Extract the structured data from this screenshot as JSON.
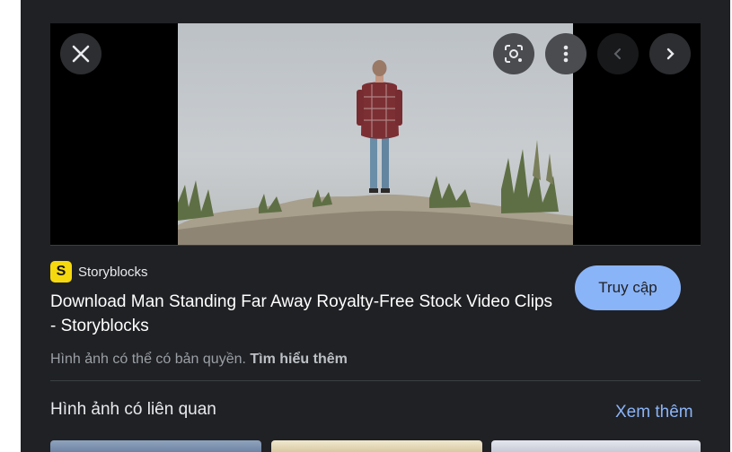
{
  "viewer": {
    "close_icon": "close-icon",
    "lens_icon": "lens-search-icon",
    "more_icon": "more-vertical-icon",
    "prev_icon": "chevron-left-icon",
    "next_icon": "chevron-right-icon"
  },
  "source": {
    "logo_letter": "S",
    "logo_color": "#f6d80f",
    "name": "Storyblocks"
  },
  "result": {
    "title": "Download Man Standing Far Away Royalty-Free Stock Video Clips - Storyblocks",
    "visit_label": "Truy cập",
    "copyright_text": "Hình ảnh có thể có bản quyền.",
    "learn_more": "Tìm hiểu thêm"
  },
  "related": {
    "title": "Hình ảnh có liên quan",
    "see_more": "Xem thêm"
  },
  "colors": {
    "panel_bg": "#202124",
    "accent": "#8ab4f8"
  }
}
